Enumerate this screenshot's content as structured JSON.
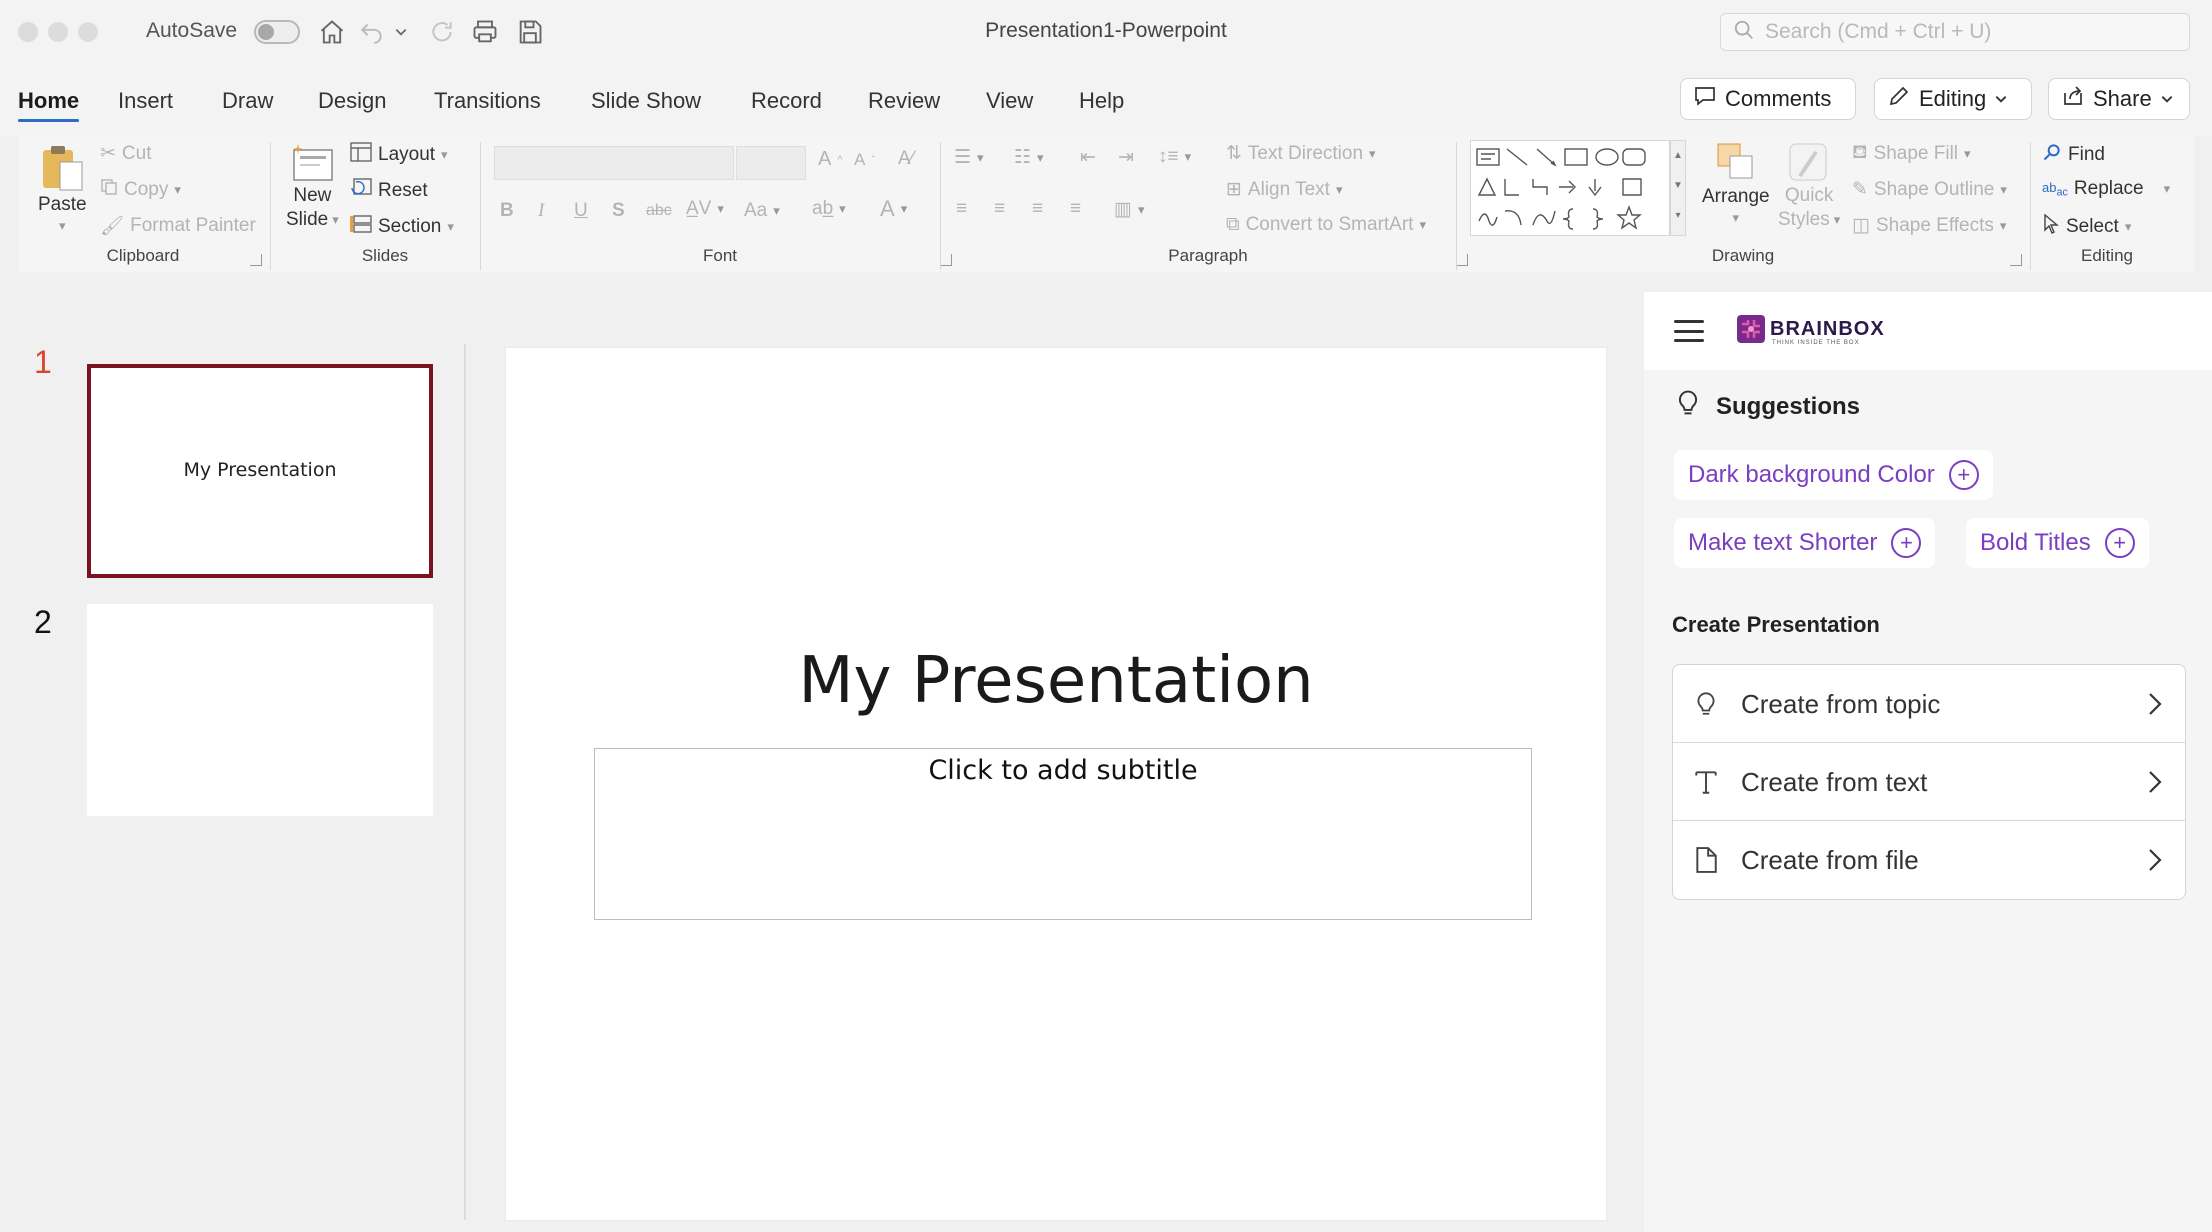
{
  "window": {
    "autosave_label": "AutoSave",
    "title": "Presentation1-Powerpoint",
    "search_placeholder": "Search (Cmd + Ctrl + U)"
  },
  "tabs": [
    "Home",
    "Insert",
    "Draw",
    "Design",
    "Transitions",
    "Slide Show",
    "Record",
    "Review",
    "View",
    "Help"
  ],
  "active_tab": "Home",
  "top_actions": {
    "comments": "Comments",
    "editing": "Editing",
    "share": "Share"
  },
  "ribbon": {
    "clipboard": {
      "label": "Clipboard",
      "paste": "Paste",
      "cut": "Cut",
      "copy": "Copy",
      "format_painter": "Format Painter"
    },
    "slides": {
      "label": "Slides",
      "new_slide_line1": "New",
      "new_slide_line2": "Slide",
      "layout": "Layout",
      "reset": "Reset",
      "section": "Section"
    },
    "font": {
      "label": "Font"
    },
    "paragraph": {
      "label": "Paragraph",
      "text_direction": "Text Direction",
      "align_text": "Align Text",
      "convert_smartart": "Convert to SmartArt"
    },
    "drawing": {
      "label": "Drawing",
      "arrange": "Arrange",
      "quick_line1": "Quick",
      "quick_line2": "Styles",
      "shape_fill": "Shape Fill",
      "shape_outline": "Shape Outline",
      "shape_effects": "Shape Effects"
    },
    "editing": {
      "label": "Editing",
      "find": "Find",
      "replace": "Replace",
      "select": "Select"
    }
  },
  "slides": [
    {
      "number": "1",
      "title": "My Presentation",
      "selected": true
    },
    {
      "number": "2",
      "title": "",
      "selected": false
    }
  ],
  "canvas": {
    "title": "My Presentation",
    "subtitle_placeholder": "Click to add subtitle"
  },
  "panel": {
    "brand": "BRAINBOX",
    "brand_tagline": "THINK INSIDE THE BOX",
    "suggestions_title": "Suggestions",
    "suggestions": [
      "Dark background Color",
      "Make text Shorter",
      "Bold Titles"
    ],
    "create_title": "Create Presentation",
    "create_options": [
      {
        "label": "Create from topic",
        "icon": "lightbulb-icon"
      },
      {
        "label": "Create from text",
        "icon": "text-t-icon"
      },
      {
        "label": "Create from file",
        "icon": "file-icon"
      }
    ]
  },
  "colors": {
    "accent_purple": "#7a3fc0",
    "selected_slide_border": "#7b1220",
    "slide_number_active": "#d9452a",
    "tab_underline": "#2b6cc4"
  }
}
